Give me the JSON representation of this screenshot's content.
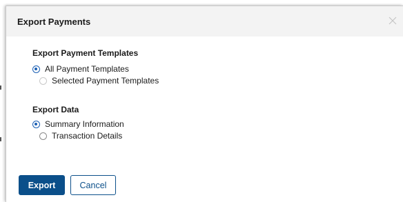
{
  "dialog": {
    "title": "Export Payments",
    "close_icon": "close-icon"
  },
  "templates_section": {
    "heading": "Export Payment Templates",
    "options": [
      {
        "label": "All Payment Templates",
        "checked": true
      },
      {
        "label": "Selected Payment Templates",
        "checked": false
      }
    ]
  },
  "data_section": {
    "heading": "Export Data",
    "options": [
      {
        "label": "Summary Information",
        "checked": true
      },
      {
        "label": "Transaction Details",
        "checked": false
      }
    ]
  },
  "actions": {
    "export_label": "Export",
    "cancel_label": "Cancel"
  },
  "colors": {
    "primary": "#0b4f8a",
    "radio_selected": "#1a5fb4",
    "header_bg": "#f3f3f3"
  }
}
